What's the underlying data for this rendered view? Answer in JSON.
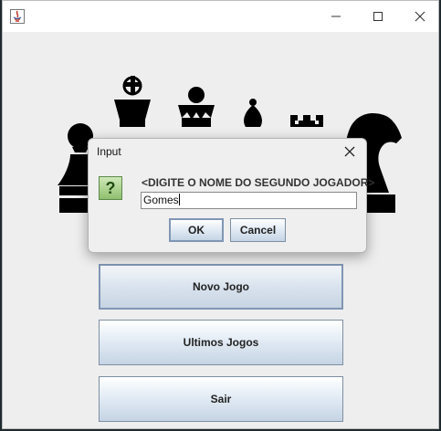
{
  "window": {
    "title": "",
    "controls": {
      "minimize": "—",
      "maximize": "☐",
      "close": "✕"
    }
  },
  "chess_pieces": [
    "pawn",
    "king",
    "queen",
    "bishop",
    "rook",
    "knight"
  ],
  "menu": {
    "new_game": "Novo Jogo",
    "last_games": "Ultimos Jogos",
    "exit": "Sair"
  },
  "dialog": {
    "title": "Input",
    "prompt": "<DIGITE O NOME DO SEGUNDO JOGADOR>",
    "input_value": "Gomes",
    "ok_label": "OK",
    "cancel_label": "Cancel",
    "icon": "question-icon"
  }
}
